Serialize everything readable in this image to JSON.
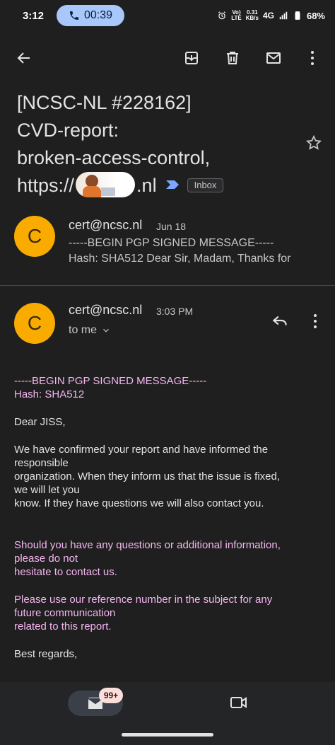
{
  "status_bar": {
    "time": "3:12",
    "call_timer": "00:39",
    "volte_top": "Vo)",
    "volte_bottom": "LTE",
    "speed_top": "0.31",
    "speed_bottom": "KB/s",
    "network": "4G",
    "battery": "68%"
  },
  "subject": {
    "line1": "[NCSC-NL #228162]",
    "line2": "CVD-report:",
    "line3": "broken-access-control,",
    "line4_prefix": "https://",
    "line4_suffix": ".nl",
    "label": "Inbox"
  },
  "messages": [
    {
      "avatar_letter": "C",
      "sender": "cert@ncsc.nl",
      "date": "Jun 18",
      "snippet_line1": "-----BEGIN PGP SIGNED MESSAGE-----",
      "snippet_line2": "Hash: SHA512 Dear Sir, Madam, Thanks for"
    },
    {
      "avatar_letter": "C",
      "sender": "cert@ncsc.nl",
      "time": "3:03 PM",
      "recipient": "to me"
    }
  ],
  "body": {
    "pgp_begin": "-----BEGIN PGP SIGNED MESSAGE-----",
    "hash": "Hash: SHA512",
    "greeting": "Dear JISS,",
    "para1": [
      "We have confirmed your report and have informed the",
      "responsible",
      "organization. When they inform us that the issue is fixed,",
      "we will let you",
      "know. If they have questions we will also contact you."
    ],
    "para2": [
      "Should you have any questions or additional information,",
      "please do not",
      "hesitate to contact us."
    ],
    "para3": [
      "Please use our reference number in the subject for any",
      "future communication",
      "related to this report."
    ],
    "closing": "Best regards,"
  },
  "bottom_nav": {
    "mail_badge": "99+"
  },
  "colors": {
    "background": "#1f1f1f",
    "avatar": "#f9ab00",
    "call_pill": "#a8c7fa",
    "pink_text": "#f4b6ef"
  }
}
